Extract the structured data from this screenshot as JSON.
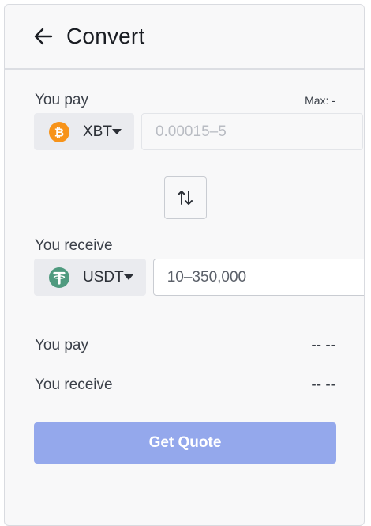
{
  "header": {
    "title": "Convert",
    "back_icon": "arrow-left-icon"
  },
  "pay": {
    "label": "You pay",
    "max_label": "Max: -",
    "asset": {
      "symbol": "XBT",
      "icon": "bitcoin-icon",
      "color": "#f7931a"
    },
    "amount_value": "",
    "amount_placeholder": "0.00015–5"
  },
  "swap": {
    "icon": "swap-vertical-icon"
  },
  "receive": {
    "label": "You receive",
    "asset": {
      "symbol": "USDT",
      "icon": "tether-icon",
      "color": "#4f9a7f"
    },
    "amount_value": "",
    "amount_placeholder": "10–350,000"
  },
  "summary": [
    {
      "label": "You pay",
      "value": "-- --"
    },
    {
      "label": "You receive",
      "value": "-- --"
    }
  ],
  "actions": {
    "quote_label": "Get Quote",
    "quote_color": "#94a8ec"
  }
}
